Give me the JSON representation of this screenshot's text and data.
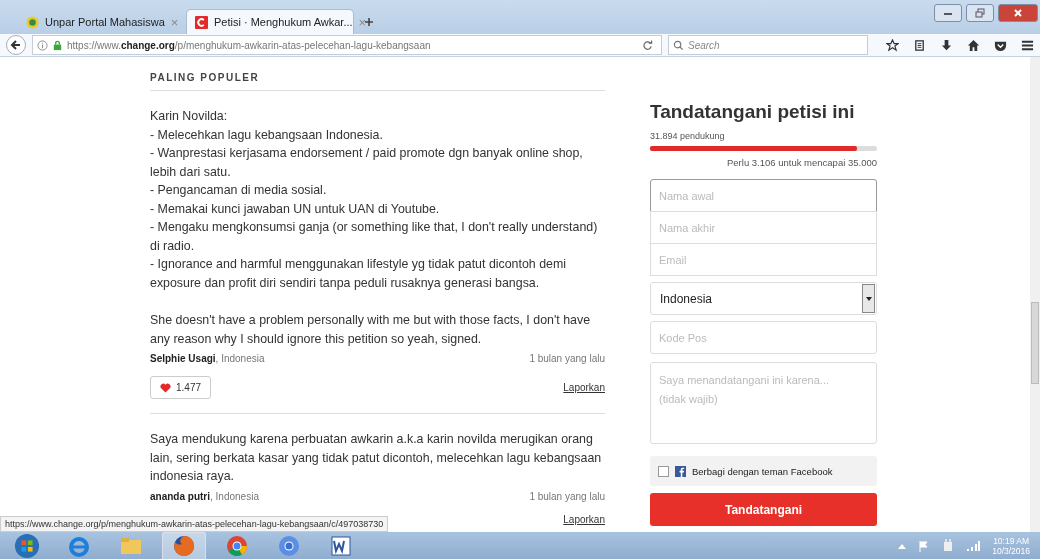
{
  "tabs": [
    {
      "title": "Unpar Portal Mahasiswa",
      "kind": "unpar",
      "close_glyph": "×",
      "selected": false
    },
    {
      "title": "Petisi · Menghukum Awkar...",
      "kind": "change",
      "close_glyph": "×",
      "selected": true
    }
  ],
  "address_bar": {
    "url_prefix": "https://www.",
    "url_domain": "change.org",
    "url_path": "/p/menghukum-awkarin-atas-pelecehan-lagu-kebangsaan"
  },
  "search": {
    "placeholder": "Search"
  },
  "section_heading": "PALING POPULER",
  "comments": [
    {
      "paragraphs": [
        [
          "Karin Novilda:",
          "- Melecehkan lagu kebangsaan Indonesia.",
          "- Wanprestasi kerjasama endorsement / paid promote dgn banyak online shop, lebih dari satu.",
          "- Pengancaman di media sosial.",
          "- Memakai kunci jawaban UN untuk UAN di Youtube.",
          "- Mengaku mengkonsumsi ganja (or something like that, I don't really understand) di radio.",
          "- Ignorance and harmful menggunakan lifestyle yg tidak patut dicontoh demi exposure dan profit diri sendiri tanpa peduli rusaknya generasi bangsa."
        ],
        [
          "She doesn't have a problem personally with me but with those facts, I don't have any reason why I should ignore this petition so yeah, signed."
        ]
      ],
      "author": "Selphie Usagi",
      "location": ", Indonesia",
      "time": "1 bulan yang lalu",
      "likes": "1.477",
      "report": "Laporkan"
    },
    {
      "paragraphs": [
        [
          "Saya mendukung karena perbuatan awkarin a.k.a karin novilda merugikan orang lain, sering berkata kasar yang tidak patut dicontoh, melecehkan lagu kebangsaan indonesia raya."
        ]
      ],
      "author": "ananda putri",
      "location": ", Indonesia",
      "time": "1 bulan yang lalu",
      "report": "Laporkan"
    }
  ],
  "sign_panel": {
    "title": "Tandatangani petisi ini",
    "supporters": "31.894 pendukung",
    "level": 0.91,
    "goal_text": "Perlu 3.106 untuk mencapai 35.000",
    "name_fields": [
      {
        "placeholder": "Nama awal"
      },
      {
        "placeholder": "Nama akhir"
      },
      {
        "placeholder": "Email"
      }
    ],
    "country": "Indonesia",
    "postcode_placeholder": "Kode Pos",
    "reason_placeholder": "Saya menandatangani ini karena...\n(tidak wajib)",
    "facebook_share": {
      "label": "Berbagi dengan teman Facebook",
      "checked": false
    },
    "button": "Tandatangani"
  },
  "status_url": "https://www.change.org/p/menghukum-awkarin-atas-pelecehan-lagu-kebangsaan/c/497038730",
  "taskbar": {
    "apps": [
      {
        "kind": "ie",
        "selected": false
      },
      {
        "kind": "folder",
        "selected": false
      },
      {
        "kind": "firefox",
        "selected": true
      },
      {
        "kind": "chrome",
        "selected": false
      },
      {
        "kind": "chromium",
        "selected": false
      },
      {
        "kind": "word",
        "selected": false
      }
    ],
    "time": "10:19 AM",
    "date": "10/3/2016"
  }
}
